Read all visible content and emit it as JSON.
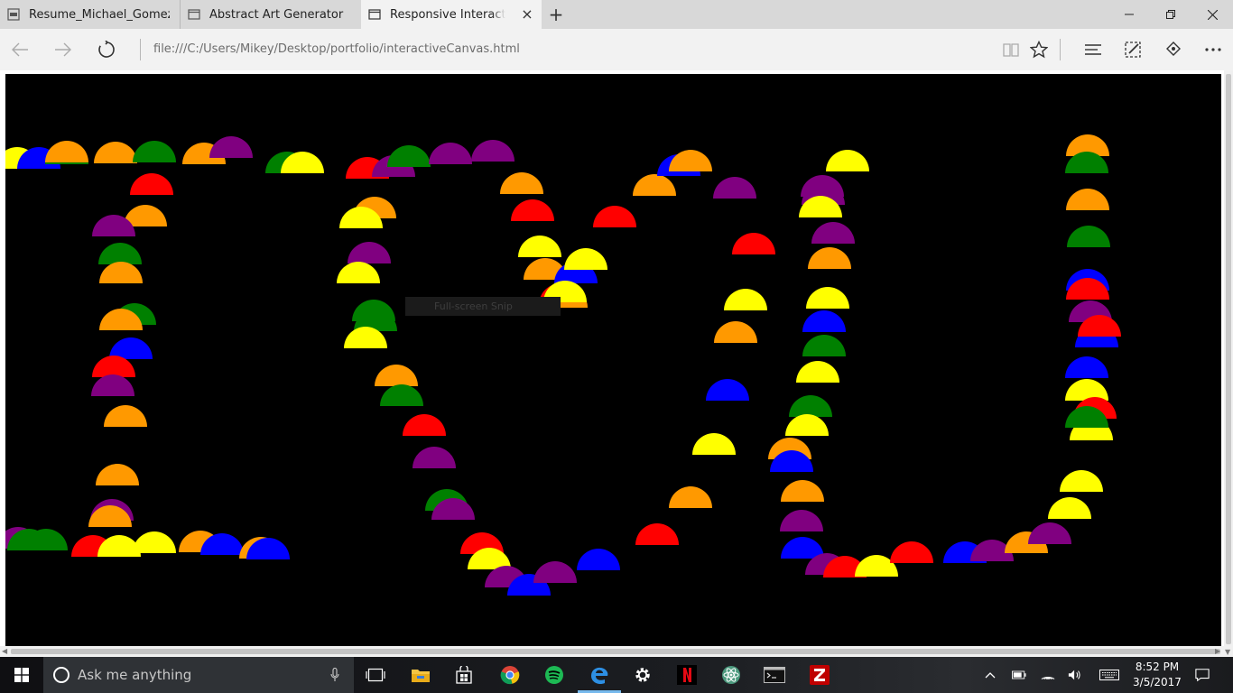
{
  "browser": {
    "tabs": [
      {
        "label": "Resume_Michael_Gomez_.p",
        "icon": "pdf-icon",
        "active": false
      },
      {
        "label": "Abstract Art Generator",
        "icon": "page-icon",
        "active": false
      },
      {
        "label": "Responsive Interactive C",
        "icon": "page-icon",
        "active": true
      }
    ],
    "url": "file:///C:/Users/Mikey/Desktop/portfolio/interactiveCanvas.html"
  },
  "overlay": {
    "snip_tooltip": "Full-screen Snip"
  },
  "canvas": {
    "background": "#000000",
    "palette": {
      "red": "#ff0000",
      "orange": "#ff9900",
      "yellow": "#ffff00",
      "green": "#008000",
      "blue": "#0000ff",
      "purple": "#800080"
    },
    "shape": "half-circle"
  },
  "taskbar": {
    "search_placeholder": "Ask me anything",
    "time": "8:52 PM",
    "date": "3/5/2017",
    "pinned": [
      "task-view-icon",
      "file-explorer-icon",
      "store-icon",
      "chrome-icon",
      "spotify-icon",
      "edge-icon",
      "settings-icon",
      "netflix-icon",
      "atom-icon",
      "cmd-icon",
      "filezilla-icon"
    ]
  }
}
